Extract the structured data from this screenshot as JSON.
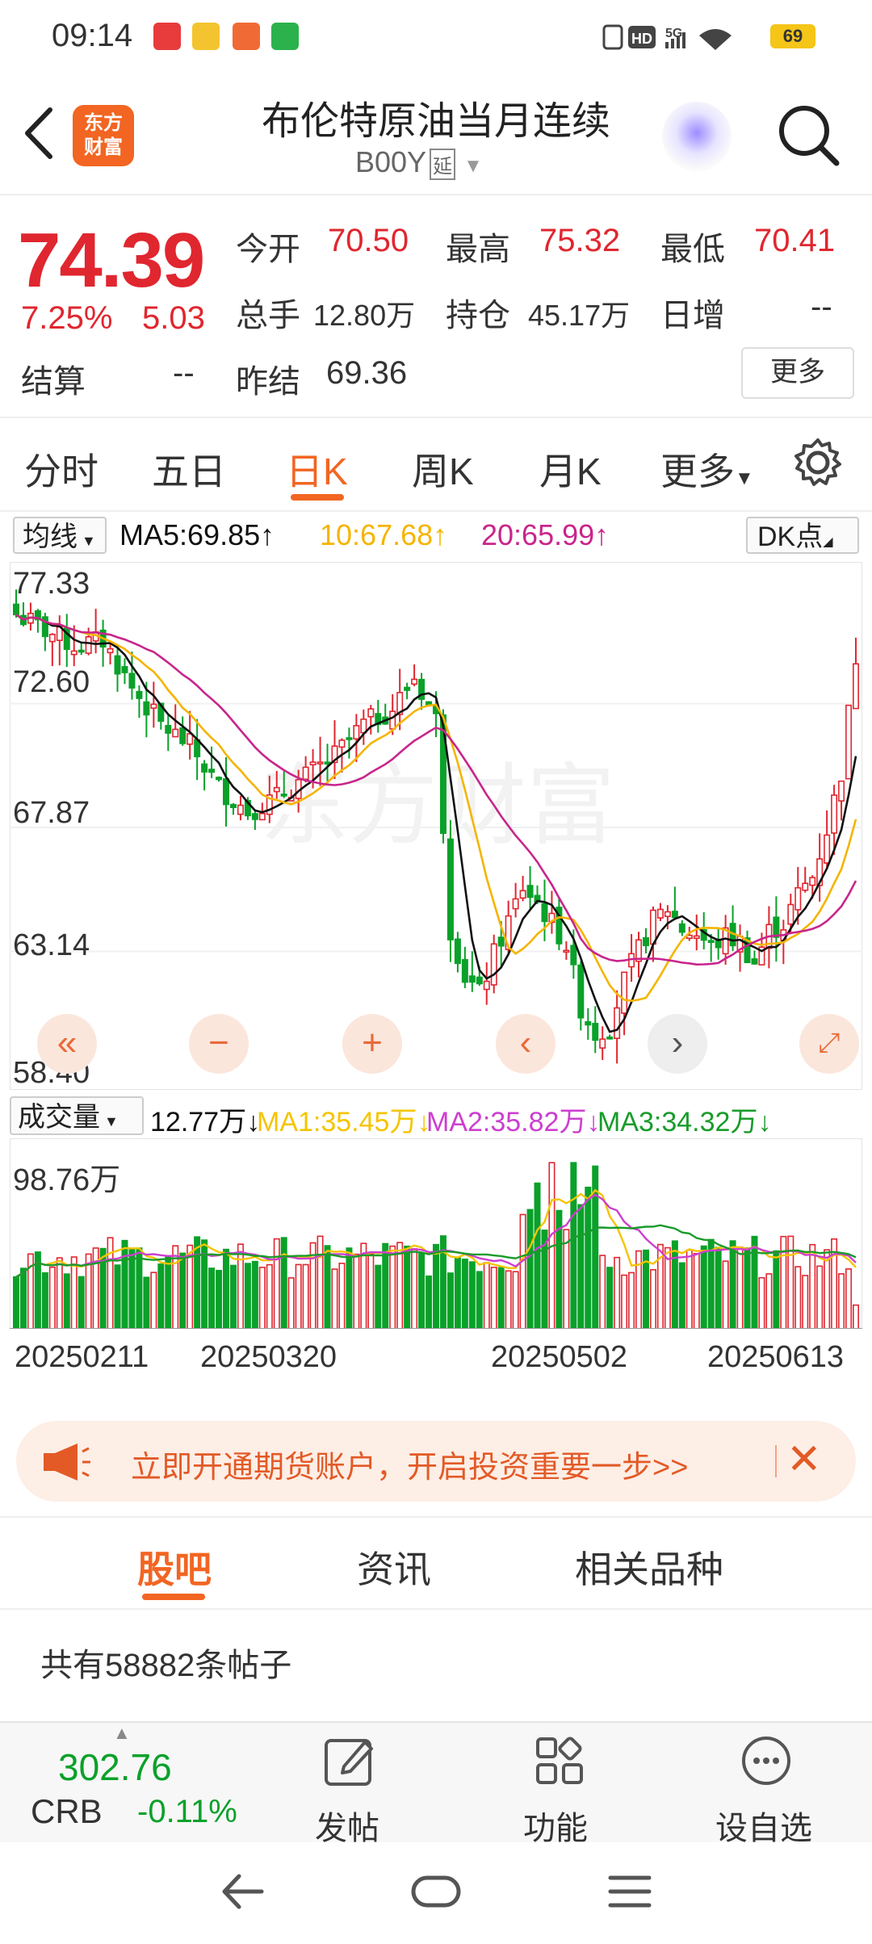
{
  "status_bar": {
    "time": "09:14",
    "network": "5G",
    "battery": "69",
    "hd": "HD"
  },
  "header": {
    "title": "布伦特原油当月连续",
    "code": "B00Y",
    "code_tag": "延",
    "logo_line1": "东方",
    "logo_line2": "财富"
  },
  "quote": {
    "price": "74.39",
    "change_pct": "7.25%",
    "change": "5.03",
    "open_label": "今开",
    "open": "70.50",
    "high_label": "最高",
    "high": "75.32",
    "low_label": "最低",
    "low": "70.41",
    "volume_label": "总手",
    "volume": "12.80万",
    "oi_label": "持仓",
    "oi": "45.17万",
    "daily_inc_label": "日增",
    "daily_inc": "--",
    "settle_label": "结算",
    "settle": "--",
    "prev_settle_label": "昨结",
    "prev_settle": "69.36",
    "more_button": "更多"
  },
  "tabs": [
    "分时",
    "五日",
    "日K",
    "周K",
    "月K",
    "更多"
  ],
  "ma_header": {
    "selector": "均线",
    "ma5": "MA5:69.85",
    "ma10": "10:67.68",
    "ma20": "20:65.99",
    "dk": "DK点"
  },
  "vol_header": {
    "selector": "成交量",
    "vol": "12.77万",
    "ma1": "MA1:35.45万",
    "ma2": "MA2:35.82万",
    "ma3": "MA3:34.32万"
  },
  "chart_data": [
    {
      "type": "candlestick",
      "yticks": [
        "77.33",
        "72.60",
        "67.87",
        "63.14",
        "58.40"
      ],
      "ylim": [
        58.4,
        77.33
      ],
      "x_dates": [
        "20250211",
        "20250320",
        "20250502",
        "20250613"
      ],
      "series": [
        {
          "name": "MA5",
          "color": "#111111"
        },
        {
          "name": "10",
          "color": "#f5b400"
        },
        {
          "name": "20",
          "color": "#c8258c"
        }
      ],
      "watermark": "东方财富"
    },
    {
      "type": "bar",
      "y_max_label": "98.76万",
      "series": [
        {
          "name": "MA1",
          "color": "#f5c400"
        },
        {
          "name": "MA2",
          "color": "#cc3fcf"
        },
        {
          "name": "MA3",
          "color": "#1a9b2b"
        }
      ]
    }
  ],
  "banner": {
    "text": "立即开通期货账户，开启投资重要一步>>"
  },
  "bottom_tabs": [
    "股吧",
    "资讯",
    "相关品种"
  ],
  "posts_count": "共有58882条帖子",
  "toolbar": {
    "index_value": "302.76",
    "index_name": "CRB",
    "index_change": "-0.11%",
    "post": "发帖",
    "function": "功能",
    "watchlist": "设自选"
  }
}
